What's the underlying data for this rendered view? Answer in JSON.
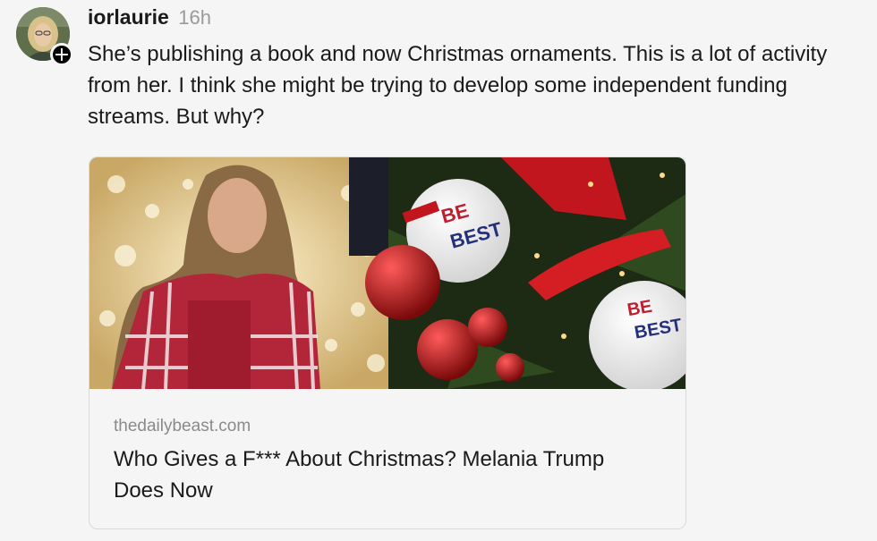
{
  "post": {
    "username": "iorlaurie",
    "timestamp": "16h",
    "text": "She’s publishing a book and now Christmas ornaments. This is a lot of activity from her. I think she might be trying to develop some independent funding streams. But why?",
    "avatar_icon": "user-avatar",
    "follow_icon": "plus-icon",
    "follow_glyph": "+"
  },
  "link_card": {
    "domain": "thedailybeast.com",
    "title": "Who Gives a F*** About Christmas? Melania Trump Does Now",
    "image_icon": "article-thumbnail-image",
    "ornament_text_line1": "BE",
    "ornament_text_line2": "BEST"
  },
  "colors": {
    "background": "#f5f5f5",
    "text": "#1a1a1a",
    "muted": "#9a9a9a",
    "border": "#d9d9d9"
  }
}
